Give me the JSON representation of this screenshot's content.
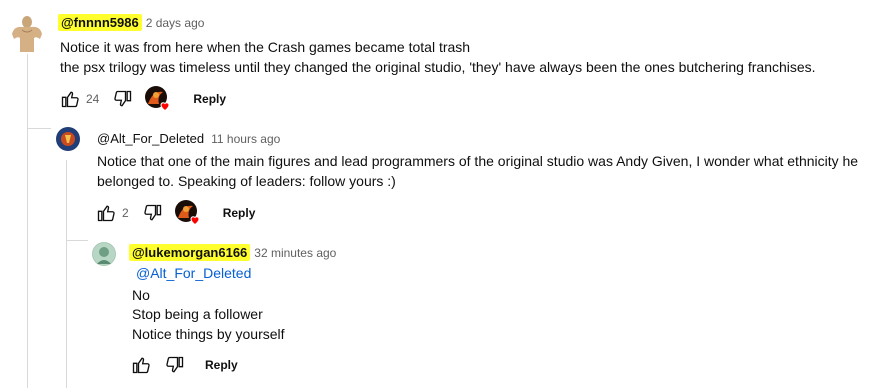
{
  "comments": [
    {
      "handle": "@fnnnn5986",
      "time": "2 days ago",
      "lines": [
        "Notice it was from here when the Crash games became total trash",
        "the psx trilogy was timeless until they changed the original studio, 'they' have always been the ones butchering franchises."
      ],
      "likes": "24",
      "reply_label": "Reply"
    },
    {
      "handle": "@Alt_For_Deleted",
      "time": "11 hours ago",
      "lines": [
        "Notice that one of the main figures and lead programmers of the original studio was Andy Given, I wonder what ethnicity he",
        "belonged to. Speaking of leaders: follow yours :)"
      ],
      "likes": "2",
      "reply_label": "Reply"
    },
    {
      "handle": "@lukemorgan6166",
      "time": "32 minutes ago",
      "mention": "@Alt_For_Deleted",
      "lines": [
        "No",
        "Stop being a follower",
        "Notice things by yourself"
      ],
      "likes": "",
      "reply_label": "Reply"
    }
  ],
  "colors": {
    "highlight": "#ffff2e",
    "mention": "#065fd4",
    "heart": "#ff0000"
  },
  "icons": [
    "like-icon",
    "dislike-icon",
    "creator-heart-icon"
  ]
}
